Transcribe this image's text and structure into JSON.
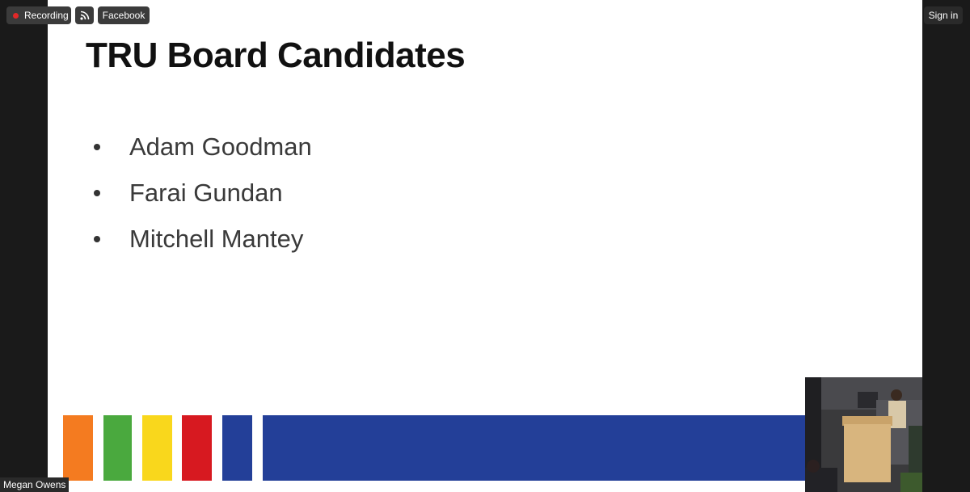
{
  "topbar": {
    "recording_label": "Recording",
    "facebook_label": "Facebook",
    "sign_in_label": "Sign in",
    "recording_dot_color": "#e22828"
  },
  "slide": {
    "title": "TRU Board Candidates",
    "bullets": [
      "Adam Goodman",
      "Farai Gundan",
      "Mitchell Mantey"
    ],
    "stripe_colors": [
      "#f47b20",
      "#4aa93e",
      "#f9d71c",
      "#d71920",
      "#233f98",
      "#233f98"
    ]
  },
  "participant": {
    "name": "Megan Owens"
  }
}
